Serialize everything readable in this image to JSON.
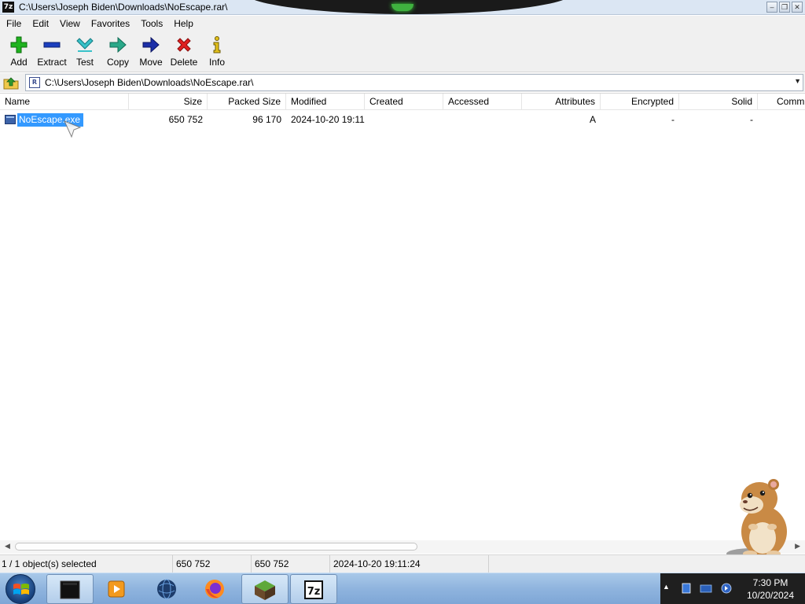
{
  "window": {
    "app_icon": "7z",
    "title": "C:\\Users\\Joseph Biden\\Downloads\\NoEscape.rar\\"
  },
  "menu": [
    "File",
    "Edit",
    "View",
    "Favorites",
    "Tools",
    "Help"
  ],
  "toolbar": [
    {
      "label": "Add",
      "icon": "add-icon"
    },
    {
      "label": "Extract",
      "icon": "extract-icon"
    },
    {
      "label": "Test",
      "icon": "test-icon"
    },
    {
      "label": "Copy",
      "icon": "copy-icon"
    },
    {
      "label": "Move",
      "icon": "move-icon"
    },
    {
      "label": "Delete",
      "icon": "delete-icon"
    },
    {
      "label": "Info",
      "icon": "info-icon"
    }
  ],
  "address": {
    "path": "C:\\Users\\Joseph Biden\\Downloads\\NoEscape.rar\\",
    "dropdown": "▼"
  },
  "columns": [
    "Name",
    "Size",
    "Packed Size",
    "Modified",
    "Created",
    "Accessed",
    "Attributes",
    "Encrypted",
    "Solid",
    "Comm"
  ],
  "files": [
    {
      "name": "NoEscape.exe",
      "size": "650 752",
      "packed_size": "96 170",
      "modified": "2024-10-20 19:11",
      "created": "",
      "accessed": "",
      "attributes": "A",
      "encrypted": "-",
      "solid": "-",
      "comment": ""
    }
  ],
  "status": {
    "selection": "1 / 1 object(s) selected",
    "size": "650 752",
    "packed": "650 752",
    "modified": "2024-10-20 19:11:24"
  },
  "taskbar": {
    "apps": [
      "terminal",
      "media-player",
      "globe",
      "firefox",
      "minecraft",
      "7-zip"
    ],
    "clock_time": "7:30 PM",
    "clock_date": "10/20/2024"
  },
  "colors": {
    "selection": "#3399ff",
    "titlebar": "#dbe6f3",
    "taskbar": "#8fb4de"
  }
}
